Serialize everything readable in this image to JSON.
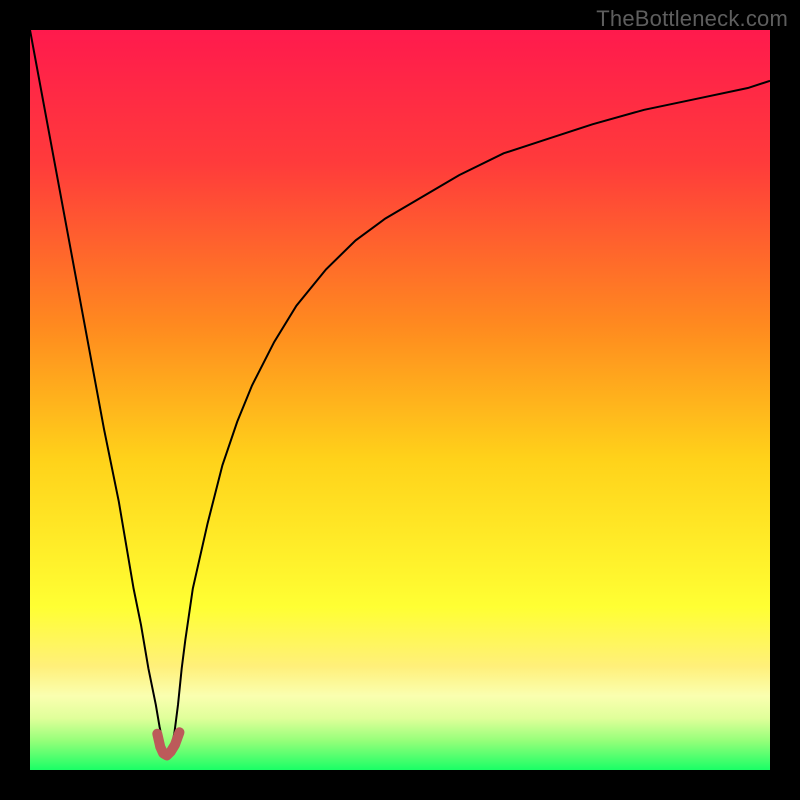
{
  "watermark": "TheBottleneck.com",
  "chart_data": {
    "type": "line",
    "title": "",
    "xlabel": "",
    "ylabel": "",
    "xlim": [
      0,
      100
    ],
    "ylim": [
      -2,
      100
    ],
    "grid": false,
    "legend": false,
    "background_gradient_stops": [
      {
        "pct": 0,
        "color": "#ff1a4d"
      },
      {
        "pct": 18,
        "color": "#ff3b3b"
      },
      {
        "pct": 40,
        "color": "#ff8a1f"
      },
      {
        "pct": 58,
        "color": "#ffd21a"
      },
      {
        "pct": 78,
        "color": "#ffff33"
      },
      {
        "pct": 86,
        "color": "#fff07a"
      },
      {
        "pct": 90,
        "color": "#faffb0"
      },
      {
        "pct": 93,
        "color": "#e0ff9a"
      },
      {
        "pct": 96,
        "color": "#97ff7a"
      },
      {
        "pct": 100,
        "color": "#1aff66"
      }
    ],
    "series": [
      {
        "name": "curve",
        "color": "#000000",
        "stroke_width": 2,
        "x": [
          0,
          2,
          4,
          6,
          8,
          10,
          12,
          14,
          15,
          16,
          17,
          17.5,
          18,
          18.5,
          19,
          19.5,
          20,
          20.5,
          21,
          22,
          24,
          26,
          28,
          30,
          33,
          36,
          40,
          44,
          48,
          53,
          58,
          64,
          70,
          76,
          83,
          90,
          97,
          100
        ],
        "y": [
          100,
          89,
          78,
          67,
          56,
          45,
          35,
          23,
          18,
          12,
          7,
          4,
          1.5,
          0.2,
          0.8,
          3,
          7,
          12,
          16,
          23,
          32,
          40,
          46,
          51,
          57,
          62,
          67,
          71,
          74,
          77,
          80,
          83,
          85,
          87,
          89,
          90.5,
          92,
          93
        ]
      },
      {
        "name": "highlight",
        "color": "#bc5a5a",
        "stroke_width": 10,
        "linecap": "round",
        "x": [
          17.2,
          17.6,
          18.0,
          18.5,
          19.0,
          19.6,
          20.2
        ],
        "y": [
          3.0,
          1.2,
          0.3,
          0.0,
          0.5,
          1.5,
          3.2
        ]
      }
    ]
  }
}
